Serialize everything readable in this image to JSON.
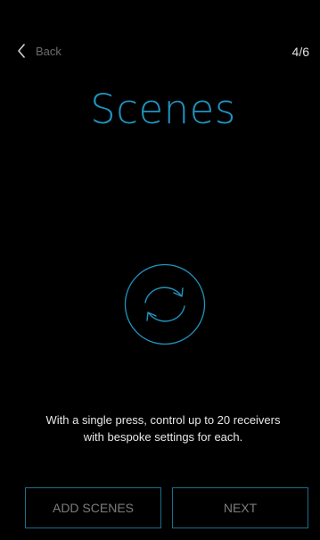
{
  "header": {
    "back_label": "Back",
    "back_icon": "chevron-left-icon",
    "step_indicator": "4/6"
  },
  "main": {
    "title": "Scenes",
    "icon": "refresh-cycle-icon",
    "description_line1": "With a single press, control up to 20 receivers",
    "description_line2": "with bespoke settings for each."
  },
  "footer": {
    "add_scenes_label": "ADD SCENES",
    "next_label": "NEXT"
  },
  "colors": {
    "background": "#000000",
    "accent": "#1f94bf",
    "button_border": "#1c6e8f",
    "text_primary": "#e8e8e8",
    "text_muted": "#7d7d7d"
  }
}
